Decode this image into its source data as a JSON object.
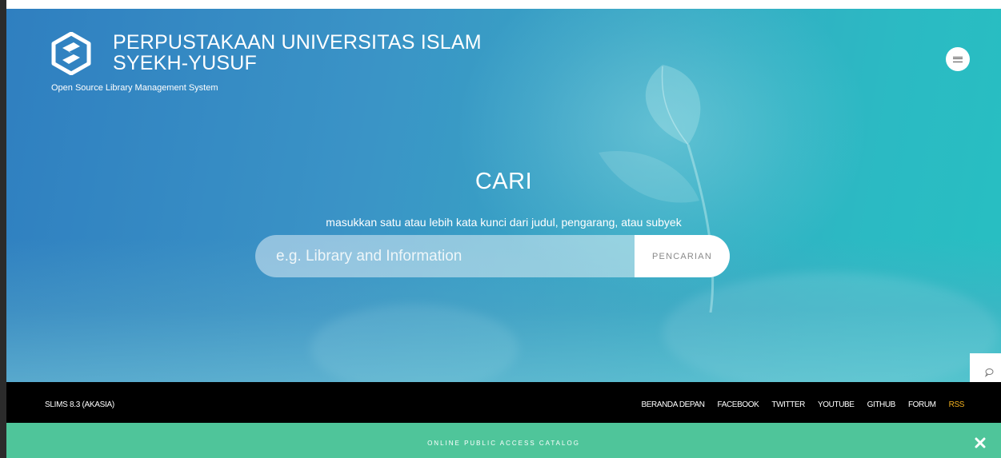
{
  "header": {
    "title_line1": "PERPUSTAKAAN UNIVERSITAS ISLAM",
    "title_line2": "SYEKH-YUSUF",
    "subtitle": "Open Source Library Management System",
    "logo_icon": "slims-logo-icon",
    "menu_icon": "menu-icon"
  },
  "search": {
    "heading": "CARI",
    "hint": "masukkan satu atau lebih kata kunci dari judul, pengarang, atau subyek",
    "placeholder": "e.g. Library and Information",
    "button_label": "PENCARIAN"
  },
  "chat": {
    "icon": "chat-bubble-icon"
  },
  "footer": {
    "version": "SLIMS 8.3 (AKASIA)",
    "links": [
      "BERANDA DEPAN",
      "FACEBOOK",
      "TWITTER",
      "YOUTUBE",
      "GITHUB",
      "FORUM",
      "RSS"
    ]
  },
  "opac": {
    "label": "ONLINE PUBLIC ACCESS CATALOG",
    "close_icon": "close-icon"
  },
  "colors": {
    "footer_bg": "#000000",
    "opac_bg": "#4fc59a",
    "rss_accent": "#f2b01e"
  }
}
